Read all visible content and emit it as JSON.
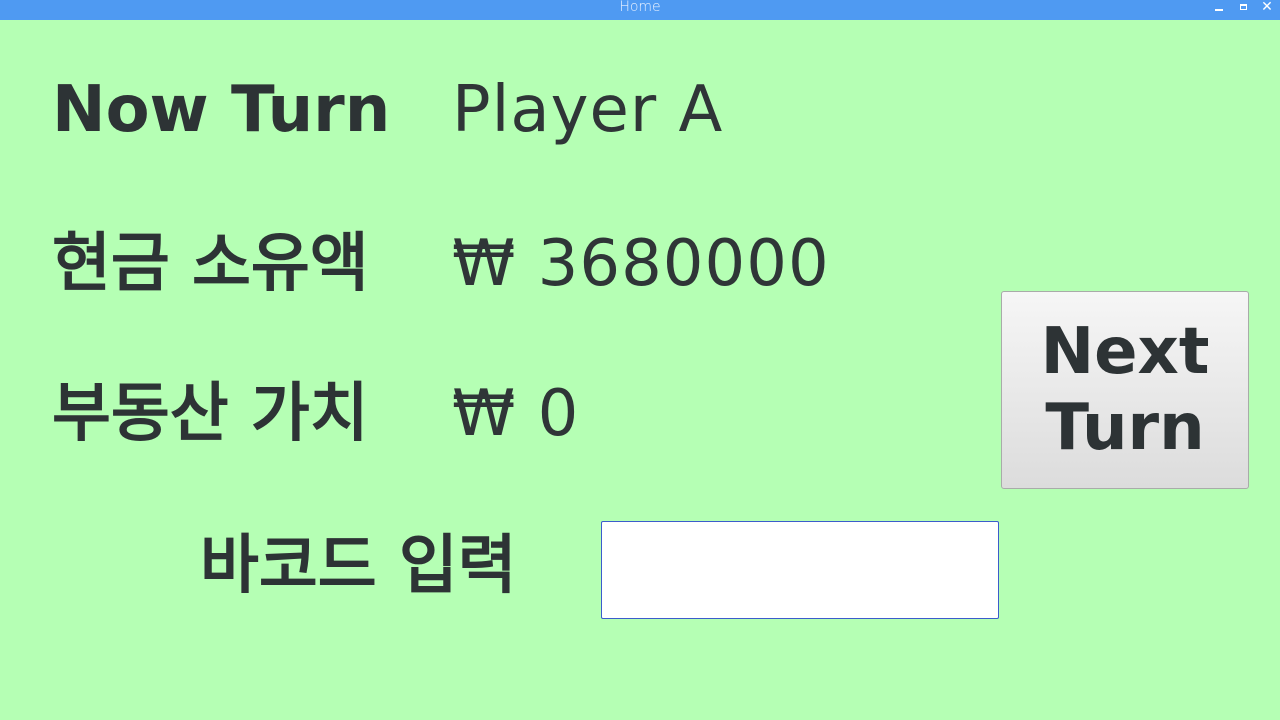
{
  "window": {
    "title": "Home",
    "controls": [
      "minimize",
      "maximize",
      "close"
    ],
    "close_glyph": "✕"
  },
  "turn": {
    "label": "Now Turn",
    "value": "Player A"
  },
  "cash": {
    "label": "현금 소유액",
    "value": "₩ 3680000"
  },
  "real_estate": {
    "label": "부동산 가치",
    "value": "₩ 0"
  },
  "barcode": {
    "label": "바코드 입력",
    "value": "",
    "placeholder": ""
  },
  "next_turn_button": {
    "label": "Next Turn"
  },
  "colors": {
    "background": "#b5ffb4",
    "titlebar": "#4f9af2",
    "text": "#2d3335",
    "input_border": "#3b5ccc"
  }
}
